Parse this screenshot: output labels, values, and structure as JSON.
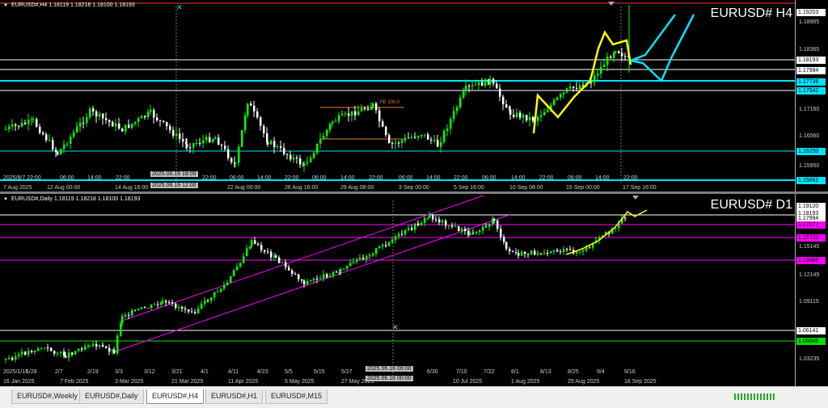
{
  "h4": {
    "header": "EURUSD#,H4  1.18119 1.18218 1.18100 1.18193",
    "big_label": "EURUSD# H4",
    "fe_label": "FE 100.0",
    "yaxis": [
      "1.19206",
      "1.18965",
      "1.18365",
      "1.17160",
      "1.16560",
      "1.15950"
    ],
    "price_boxes": [
      {
        "value": "1.19203",
        "bg": "#ffffff"
      },
      {
        "value": "1.18193",
        "bg": "#ffffff"
      },
      {
        "value": "1.17994",
        "bg": "#ffffff"
      },
      {
        "value": "1.17736",
        "bg": "#00e5ff"
      },
      {
        "value": "1.17542",
        "bg": "#00e5ff"
      },
      {
        "value": "1.16250",
        "bg": "#00e5ff"
      },
      {
        "value": "1.15662",
        "bg": "#00e5ff"
      }
    ],
    "xaxis": [
      "2025/8/7 22:00",
      "06:00",
      "14:00",
      "22:00",
      "06:00",
      "14:00",
      "22:00",
      "06:00",
      "14:00",
      "22:00",
      "06:00",
      "14:00",
      "22:00",
      "06:00",
      "14:00",
      "22:00",
      "06:00",
      "14:00",
      "22:00",
      "06:00",
      "14:00",
      "22:00"
    ],
    "xaxis_dates": [
      "7 Aug 2025",
      "12 Aug 00:00",
      "14 Aug 16:00",
      "22 Aug 00:00",
      "26 Aug 16:00",
      "29 Aug 08:00",
      "3 Sep 00:00",
      "5 Sep 16:00",
      "10 Sep 08:00",
      "15 Sep 00:00",
      "17 Sep 16:00"
    ],
    "crosshair_labels": [
      "2025.08.19 18:00",
      "2025.08.19 12:00"
    ]
  },
  "d1": {
    "header": "EURUSD#,Daily  1.18119 1.18218 1.18100 1.18193",
    "big_label": "EURUSD# D1",
    "yaxis": [
      "1.19120",
      "1.17994",
      "1.15145",
      "1.12145",
      "1.09115",
      "1.06141",
      "1.03235"
    ],
    "price_boxes": [
      {
        "value": "1.19120",
        "bg": "#ffffff"
      },
      {
        "value": "1.18193",
        "bg": "#ffffff"
      },
      {
        "value": "1.17994",
        "bg": "#ffffff"
      },
      {
        "value": "1.17277",
        "bg": "#ff00ff"
      },
      {
        "value": "1.15733",
        "bg": "#ff00ff"
      },
      {
        "value": "1.13488",
        "bg": "#ff00ff"
      },
      {
        "value": "1.06141",
        "bg": "#ffffff"
      },
      {
        "value": "1.05046",
        "bg": "#00e000"
      }
    ],
    "xaxis_top": [
      "2025/1/16",
      "1/28",
      "2/7",
      "2/19",
      "3/3",
      "3/12",
      "3/21",
      "4/1",
      "4/11",
      "4/23",
      "5/5",
      "5/15",
      "5/27",
      "6/30",
      "7/10",
      "7/22",
      "8/1",
      "8/13",
      "8/25",
      "9/4",
      "9/16"
    ],
    "xaxis_bottom": [
      "16 Jan 2025",
      "7 Feb 2025",
      "3 Mar 2025",
      "21 Mar 2025",
      "11 Apr 2025",
      "5 May 2025",
      "27 May 2025",
      "10 Jul 2025",
      "1 Aug 2025",
      "25 Aug 2025",
      "16 Sep 2025"
    ],
    "crosshair_labels": [
      "2025.06.16 06:00",
      "2025.06.16 00:00"
    ]
  },
  "tabs": [
    "EURUSD#,Weekly",
    "EURUSD#,Daily",
    "EURUSD#,H4",
    "EURUSD#,H1",
    "EURUSD#,M15"
  ],
  "active_tab": "EURUSD#,H4",
  "colors": {
    "bull": "#00ff00",
    "bear": "#ffffff",
    "forecast": "#ffff00",
    "projection": "#00e5ff",
    "channel": "#ff00ff"
  }
}
